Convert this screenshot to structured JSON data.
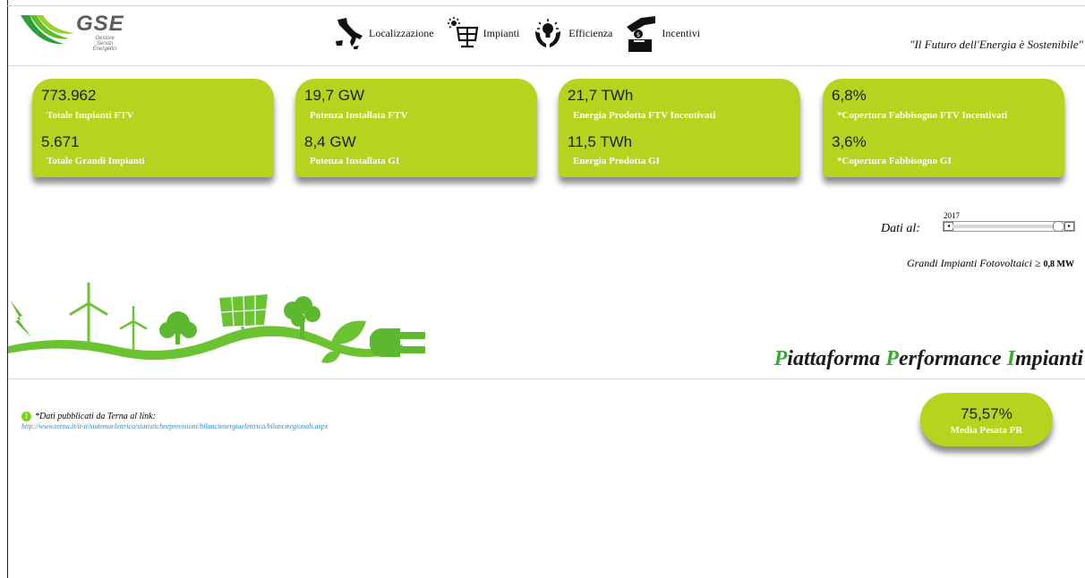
{
  "header": {
    "logo": {
      "text": "GSE",
      "sub": [
        "Gestore",
        "Servizi",
        "Energetici"
      ]
    },
    "nav": [
      {
        "label": "Localizzazione",
        "icon": "italy-map-icon"
      },
      {
        "label": "Impianti",
        "icon": "solar-panel-icon"
      },
      {
        "label": "Efficienza",
        "icon": "lightbulb-hands-icon"
      },
      {
        "label": "Incentivi",
        "icon": "coin-hand-icon"
      }
    ],
    "tagline": "\"Il Futuro dell'Energia è Sostenibile\""
  },
  "cards": [
    {
      "value1": "773.962",
      "label1": "Totale Impianti FTV",
      "value2": "5.671",
      "label2": "Totale Grandi Impianti"
    },
    {
      "value1": "19,7 GW",
      "label1": "Potenza Installata FTV",
      "value2": "8,4 GW",
      "label2": "Potenza Installata GI"
    },
    {
      "value1": "21,7 TWh",
      "label1": "Energia Prodotta FTV Incentivati",
      "value2": "11,5 TWh",
      "label2": "Energia Prodotta GI"
    },
    {
      "value1": "6,8%",
      "label1": "*Copertura Fabbisogno FTV Incentivati",
      "value2": "3,6%",
      "label2": "*Copertura Fabbisogno GI"
    }
  ],
  "slider": {
    "label": "Dati al:",
    "year": "2017",
    "position": 1.0
  },
  "gi_note": {
    "text": "Grandi Impianti Fotovoltaici ≥ ",
    "value": "0,8 MW"
  },
  "platform_title": {
    "p1": "P",
    "r1": "iattaforma ",
    "p2": "P",
    "r2": "erformance ",
    "p3": "I",
    "r3": "mpianti"
  },
  "info": {
    "text": "*Dati pubblicati da Terna al link:",
    "link": "http://www.terna.it/it-it/sistemaelettrico/statisticheeprevisioni/bilancienergiaelettrica/bilanciregionali.aspx"
  },
  "pr": {
    "value": "75,57%",
    "label": "Media Pesata PR"
  },
  "colors": {
    "accent": "#b5d41f",
    "green_dark": "#5cb82e",
    "brand_green": "#3aaa35",
    "link": "#2b8ad6"
  }
}
